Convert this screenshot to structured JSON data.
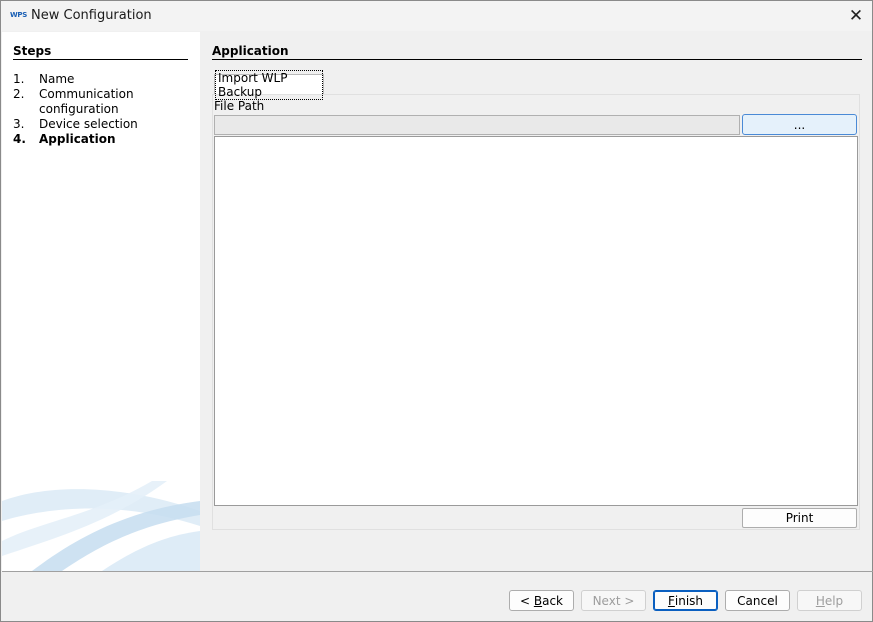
{
  "window": {
    "app_icon_text": "WPS",
    "title": "New Configuration"
  },
  "steps": {
    "title": "Steps",
    "items": [
      {
        "num": "1.",
        "label": "Name"
      },
      {
        "num": "2.",
        "label": "Communication configuration"
      },
      {
        "num": "3.",
        "label": "Device selection"
      },
      {
        "num": "4.",
        "label": "Application",
        "active": true
      }
    ]
  },
  "main": {
    "section_title": "Application",
    "tab_label": "Import WLP Backup",
    "file_path_label": "File Path",
    "file_path_value": "",
    "browse_label": "...",
    "print_label": "Print"
  },
  "buttons": {
    "back_prefix": "< ",
    "back_mnemonic": "B",
    "back_rest": "ack",
    "next": "Next >",
    "finish_mnemonic": "F",
    "finish_rest": "inish",
    "cancel": "Cancel",
    "help_mnemonic": "H",
    "help_rest": "elp"
  },
  "colors": {
    "accent": "#0a5fc0",
    "browse_bg": "#e5f1fb"
  }
}
